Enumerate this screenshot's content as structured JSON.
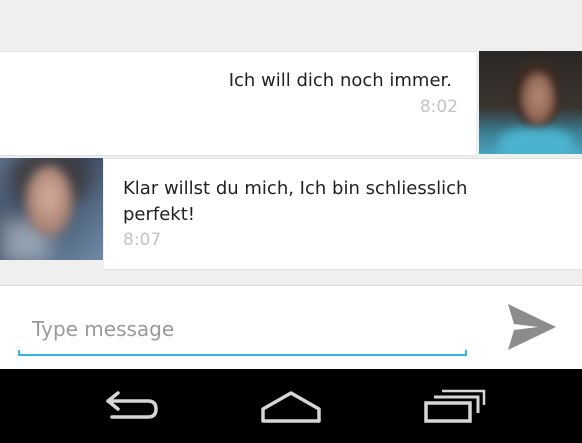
{
  "conversation": {
    "messages": [
      {
        "direction": "outgoing",
        "text": "Ich will dich noch immer.",
        "time": "8:02"
      },
      {
        "direction": "incoming",
        "text": "Klar willst du mich, Ich bin schliesslich perfekt!",
        "time": "8:07"
      }
    ]
  },
  "composer": {
    "placeholder": "Type message",
    "value": "",
    "accent_color": "#33b5e5",
    "send_icon": "send-icon"
  },
  "nav_bar": {
    "back_icon": "back-icon",
    "home_icon": "home-icon",
    "recents_icon": "recents-icon"
  }
}
